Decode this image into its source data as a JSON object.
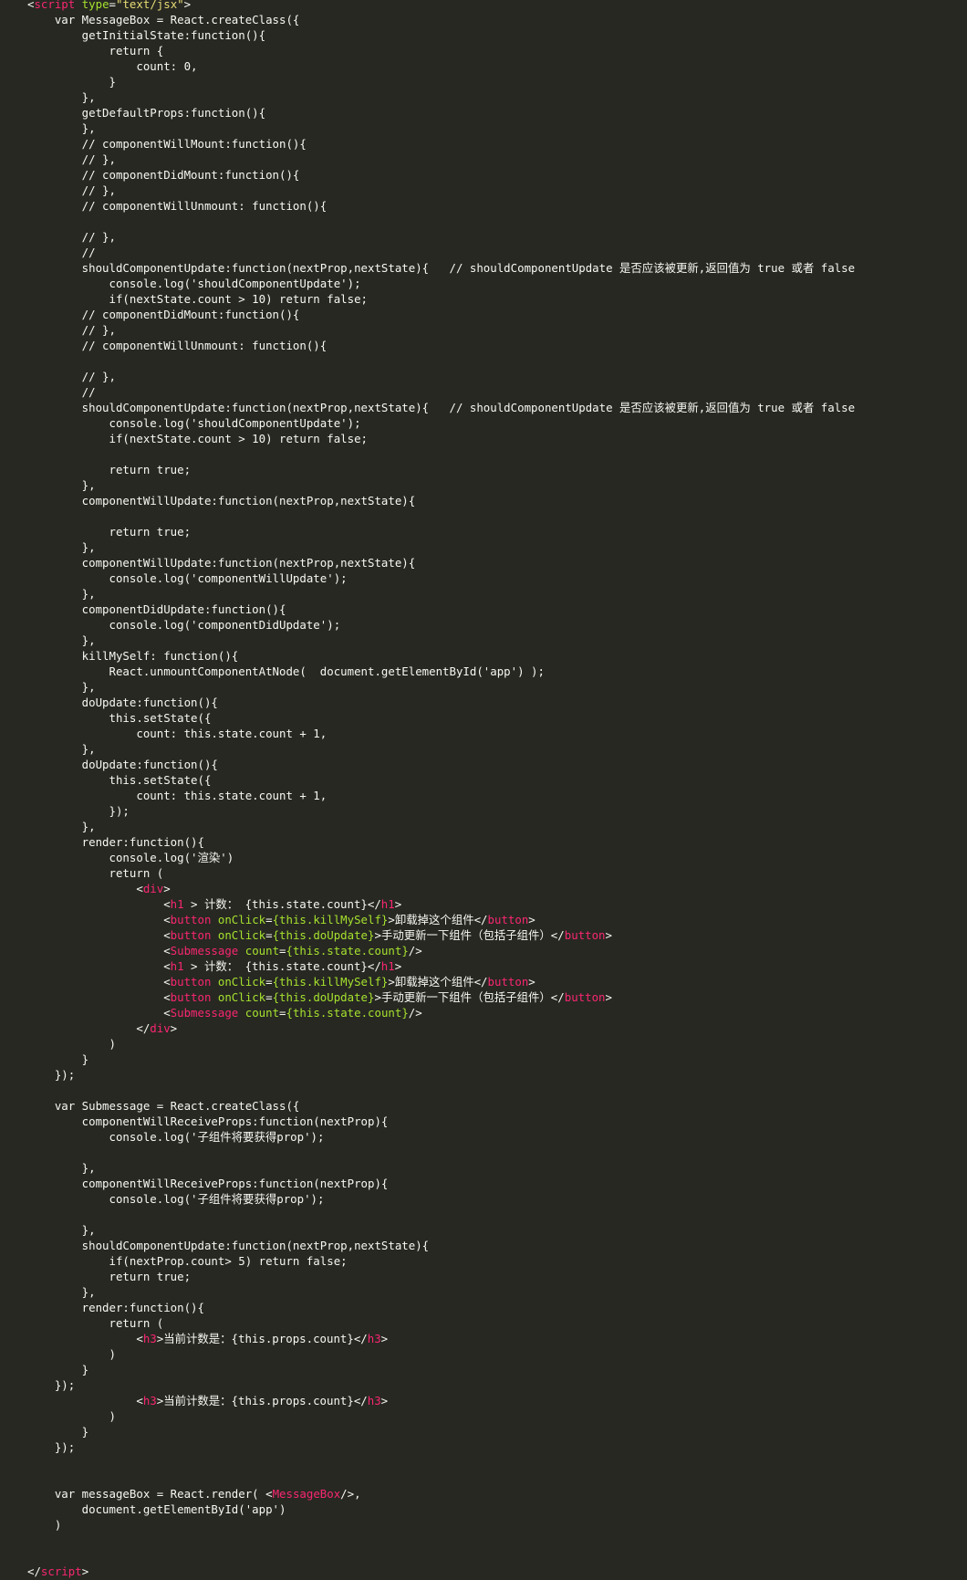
{
  "editor": {
    "theme": {
      "background": "#272822",
      "text": "#f8f8f2",
      "tag": "#f92672",
      "attr": "#a6e22e",
      "string": "#e6db74"
    },
    "lines": [
      [
        [
          "p",
          "<"
        ],
        [
          "t",
          "script"
        ],
        [
          "p",
          " "
        ],
        [
          "a",
          "type"
        ],
        [
          "p",
          "="
        ],
        [
          "s",
          "\"text/jsx\""
        ],
        [
          "p",
          ">"
        ]
      ],
      [
        [
          "p",
          "    var MessageBox = React.createClass({"
        ]
      ],
      [
        [
          "p",
          "        getInitialState:function(){"
        ]
      ],
      [
        [
          "p",
          "            return {"
        ]
      ],
      [
        [
          "p",
          "                count: 0,"
        ]
      ],
      [
        [
          "p",
          "            }"
        ]
      ],
      [
        [
          "p",
          "        },"
        ]
      ],
      [
        [
          "p",
          "        getDefaultProps:function(){"
        ]
      ],
      [
        [
          "p",
          "        },"
        ]
      ],
      [
        [
          "p",
          "        // componentWillMount:function(){"
        ]
      ],
      [
        [
          "p",
          "        // },"
        ]
      ],
      [
        [
          "p",
          "        // componentDidMount:function(){"
        ]
      ],
      [
        [
          "p",
          "        // },"
        ]
      ],
      [
        [
          "p",
          "        // componentWillUnmount: function(){"
        ]
      ],
      [
        [
          "p",
          ""
        ]
      ],
      [
        [
          "p",
          "        // },"
        ]
      ],
      [
        [
          "p",
          "        //"
        ]
      ],
      [
        [
          "p",
          "        shouldComponentUpdate:function(nextProp,nextState){   // shouldComponentUpdate 是否应该被更新,返回值为 true 或者 false"
        ]
      ],
      [
        [
          "p",
          "            console.log('shouldComponentUpdate');"
        ]
      ],
      [
        [
          "p",
          "            if(nextState.count > 10) return false;"
        ]
      ],
      [
        [
          "p",
          "        // componentDidMount:function(){"
        ]
      ],
      [
        [
          "p",
          "        // },"
        ]
      ],
      [
        [
          "p",
          "        // componentWillUnmount: function(){"
        ]
      ],
      [
        [
          "p",
          ""
        ]
      ],
      [
        [
          "p",
          "        // },"
        ]
      ],
      [
        [
          "p",
          "        //"
        ]
      ],
      [
        [
          "p",
          "        shouldComponentUpdate:function(nextProp,nextState){   // shouldComponentUpdate 是否应该被更新,返回值为 true 或者 false"
        ]
      ],
      [
        [
          "p",
          "            console.log('shouldComponentUpdate');"
        ]
      ],
      [
        [
          "p",
          "            if(nextState.count > 10) return false;"
        ]
      ],
      [
        [
          "p",
          ""
        ]
      ],
      [
        [
          "p",
          "            return true;"
        ]
      ],
      [
        [
          "p",
          "        },"
        ]
      ],
      [
        [
          "p",
          "        componentWillUpdate:function(nextProp,nextState){"
        ]
      ],
      [
        [
          "p",
          ""
        ]
      ],
      [
        [
          "p",
          "            return true;"
        ]
      ],
      [
        [
          "p",
          "        },"
        ]
      ],
      [
        [
          "p",
          "        componentWillUpdate:function(nextProp,nextState){"
        ]
      ],
      [
        [
          "p",
          "            console.log('componentWillUpdate');"
        ]
      ],
      [
        [
          "p",
          "        },"
        ]
      ],
      [
        [
          "p",
          "        componentDidUpdate:function(){"
        ]
      ],
      [
        [
          "p",
          "            console.log('componentDidUpdate');"
        ]
      ],
      [
        [
          "p",
          "        },"
        ]
      ],
      [
        [
          "p",
          "        killMySelf: function(){"
        ]
      ],
      [
        [
          "p",
          "            React.unmountComponentAtNode(  document.getElementById('app') );"
        ]
      ],
      [
        [
          "p",
          "        },"
        ]
      ],
      [
        [
          "p",
          "        doUpdate:function(){"
        ]
      ],
      [
        [
          "p",
          "            this.setState({"
        ]
      ],
      [
        [
          "p",
          "                count: this.state.count + 1,"
        ]
      ],
      [
        [
          "p",
          "        },"
        ]
      ],
      [
        [
          "p",
          "        doUpdate:function(){"
        ]
      ],
      [
        [
          "p",
          "            this.setState({"
        ]
      ],
      [
        [
          "p",
          "                count: this.state.count + 1,"
        ]
      ],
      [
        [
          "p",
          "            });"
        ]
      ],
      [
        [
          "p",
          "        },"
        ]
      ],
      [
        [
          "p",
          "        render:function(){"
        ]
      ],
      [
        [
          "p",
          "            console.log('渲染')"
        ]
      ],
      [
        [
          "p",
          "            return ("
        ]
      ],
      [
        [
          "p",
          "                <"
        ],
        [
          "t",
          "div"
        ],
        [
          "p",
          ">"
        ]
      ],
      [
        [
          "p",
          "                    <"
        ],
        [
          "t",
          "h1"
        ],
        [
          "p",
          " > 计数： {this.state.count}</"
        ],
        [
          "t",
          "h1"
        ],
        [
          "p",
          ">"
        ]
      ],
      [
        [
          "p",
          "                    <"
        ],
        [
          "t",
          "button"
        ],
        [
          "p",
          " "
        ],
        [
          "a",
          "onClick"
        ],
        [
          "p",
          "="
        ],
        [
          "a",
          "{this.killMySelf}"
        ],
        [
          "p",
          ">卸载掉这个组件</"
        ],
        [
          "t",
          "button"
        ],
        [
          "p",
          ">"
        ]
      ],
      [
        [
          "p",
          "                    <"
        ],
        [
          "t",
          "button"
        ],
        [
          "p",
          " "
        ],
        [
          "a",
          "onClick"
        ],
        [
          "p",
          "="
        ],
        [
          "a",
          "{this.doUpdate}"
        ],
        [
          "p",
          ">手动更新一下组件（包括子组件）</"
        ],
        [
          "t",
          "button"
        ],
        [
          "p",
          ">"
        ]
      ],
      [
        [
          "p",
          "                    <"
        ],
        [
          "t",
          "Submessage"
        ],
        [
          "p",
          " "
        ],
        [
          "a",
          "count"
        ],
        [
          "p",
          "="
        ],
        [
          "a",
          "{this.state.count}"
        ],
        [
          "p",
          "/>"
        ]
      ],
      [
        [
          "p",
          "                    <"
        ],
        [
          "t",
          "h1"
        ],
        [
          "p",
          " > 计数： {this.state.count}</"
        ],
        [
          "t",
          "h1"
        ],
        [
          "p",
          ">"
        ]
      ],
      [
        [
          "p",
          "                    <"
        ],
        [
          "t",
          "button"
        ],
        [
          "p",
          " "
        ],
        [
          "a",
          "onClick"
        ],
        [
          "p",
          "="
        ],
        [
          "a",
          "{this.killMySelf}"
        ],
        [
          "p",
          ">卸载掉这个组件</"
        ],
        [
          "t",
          "button"
        ],
        [
          "p",
          ">"
        ]
      ],
      [
        [
          "p",
          "                    <"
        ],
        [
          "t",
          "button"
        ],
        [
          "p",
          " "
        ],
        [
          "a",
          "onClick"
        ],
        [
          "p",
          "="
        ],
        [
          "a",
          "{this.doUpdate}"
        ],
        [
          "p",
          ">手动更新一下组件（包括子组件）</"
        ],
        [
          "t",
          "button"
        ],
        [
          "p",
          ">"
        ]
      ],
      [
        [
          "p",
          "                    <"
        ],
        [
          "t",
          "Submessage"
        ],
        [
          "p",
          " "
        ],
        [
          "a",
          "count"
        ],
        [
          "p",
          "="
        ],
        [
          "a",
          "{this.state.count}"
        ],
        [
          "p",
          "/>"
        ]
      ],
      [
        [
          "p",
          "                </"
        ],
        [
          "t",
          "div"
        ],
        [
          "p",
          ">"
        ]
      ],
      [
        [
          "p",
          "            )"
        ]
      ],
      [
        [
          "p",
          "        }"
        ]
      ],
      [
        [
          "p",
          "    });"
        ]
      ],
      [
        [
          "p",
          ""
        ]
      ],
      [
        [
          "p",
          "    var Submessage = React.createClass({"
        ]
      ],
      [
        [
          "p",
          "        componentWillReceiveProps:function(nextProp){"
        ]
      ],
      [
        [
          "p",
          "            console.log('子组件将要获得prop');"
        ]
      ],
      [
        [
          "p",
          ""
        ]
      ],
      [
        [
          "p",
          "        },"
        ]
      ],
      [
        [
          "p",
          "        componentWillReceiveProps:function(nextProp){"
        ]
      ],
      [
        [
          "p",
          "            console.log('子组件将要获得prop');"
        ]
      ],
      [
        [
          "p",
          ""
        ]
      ],
      [
        [
          "p",
          "        },"
        ]
      ],
      [
        [
          "p",
          "        shouldComponentUpdate:function(nextProp,nextState){"
        ]
      ],
      [
        [
          "p",
          "            if(nextProp.count> 5) return false;"
        ]
      ],
      [
        [
          "p",
          "            return true;"
        ]
      ],
      [
        [
          "p",
          "        },"
        ]
      ],
      [
        [
          "p",
          "        render:function(){"
        ]
      ],
      [
        [
          "p",
          "            return ("
        ]
      ],
      [
        [
          "p",
          "                <"
        ],
        [
          "t",
          "h3"
        ],
        [
          "p",
          ">当前计数是：{this.props.count}</"
        ],
        [
          "t",
          "h3"
        ],
        [
          "p",
          ">"
        ]
      ],
      [
        [
          "p",
          "            )"
        ]
      ],
      [
        [
          "p",
          "        }"
        ]
      ],
      [
        [
          "p",
          "    });"
        ]
      ],
      [
        [
          "p",
          "                <"
        ],
        [
          "t",
          "h3"
        ],
        [
          "p",
          ">当前计数是：{this.props.count}</"
        ],
        [
          "t",
          "h3"
        ],
        [
          "p",
          ">"
        ]
      ],
      [
        [
          "p",
          "            )"
        ]
      ],
      [
        [
          "p",
          "        }"
        ]
      ],
      [
        [
          "p",
          "    });"
        ]
      ],
      [
        [
          "p",
          ""
        ]
      ],
      [
        [
          "p",
          ""
        ]
      ],
      [
        [
          "p",
          "    var messageBox = React.render( <"
        ],
        [
          "t",
          "MessageBox"
        ],
        [
          "p",
          "/>,"
        ]
      ],
      [
        [
          "p",
          "        document.getElementById('app')"
        ]
      ],
      [
        [
          "p",
          "    )"
        ]
      ],
      [
        [
          "p",
          ""
        ]
      ],
      [
        [
          "p",
          ""
        ]
      ],
      [
        [
          "p",
          "</"
        ],
        [
          "t",
          "script"
        ],
        [
          "p",
          ">"
        ]
      ]
    ]
  }
}
